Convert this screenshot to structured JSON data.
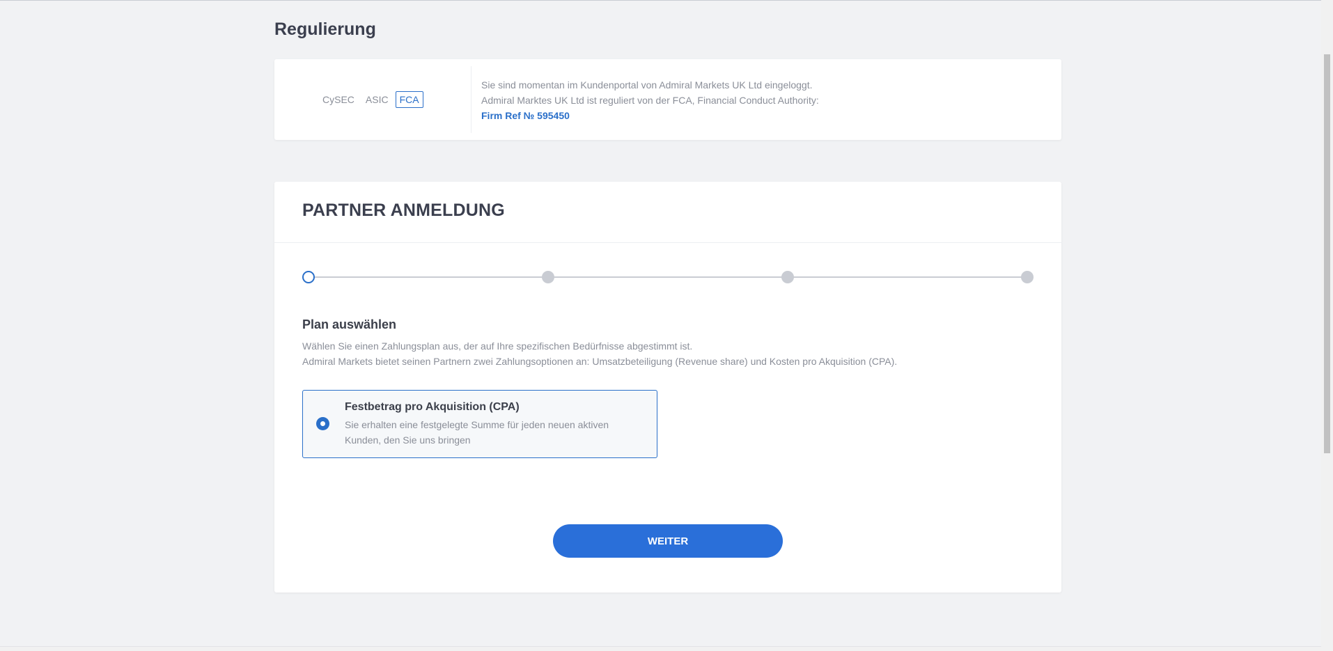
{
  "regulation": {
    "title": "Regulierung",
    "tabs": [
      {
        "label": "CySEC",
        "active": false
      },
      {
        "label": "ASIC",
        "active": false
      },
      {
        "label": "FCA",
        "active": true
      }
    ],
    "info_line1": "Sie sind momentan im Kundenportal von Admiral Markets UK Ltd eingeloggt.",
    "info_line2": "Admiral Marktes UK Ltd ist reguliert von der FCA, Financial Conduct Authority:",
    "firm_ref": "Firm Ref № 595450"
  },
  "registration": {
    "title": "PARTNER ANMELDUNG",
    "steps_total": 4,
    "current_step": 1,
    "plan_heading": "Plan auswählen",
    "plan_desc_line1": "Wählen Sie einen Zahlungsplan aus, der auf Ihre spezifischen Bedürfnisse abgestimmt ist.",
    "plan_desc_line2": "Admiral Markets bietet seinen Partnern zwei Zahlungsoptionen an: Umsatzbeteiligung (Revenue share) und Kosten pro Akquisition (CPA).",
    "option": {
      "title": "Festbetrag pro Akquisition (CPA)",
      "description": "Sie erhalten eine festgelegte Summe für jeden neuen aktiven Kunden, den Sie uns bringen",
      "selected": true
    },
    "next_label": "WEITER"
  },
  "colors": {
    "accent": "#2a6fc9",
    "button": "#2a6fd9",
    "background": "#f1f2f4"
  }
}
